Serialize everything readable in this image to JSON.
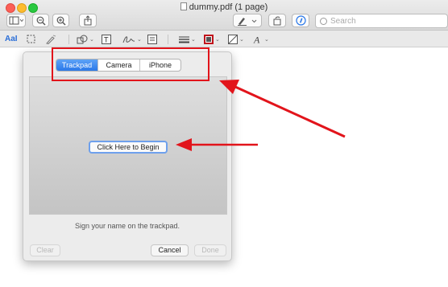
{
  "window": {
    "title": "dummy.pdf (1 page)"
  },
  "toolbar": {
    "search_placeholder": "Search"
  },
  "markup": {
    "text_label": "AaI"
  },
  "signature_panel": {
    "tabs": [
      {
        "label": "Trackpad",
        "active": true
      },
      {
        "label": "Camera",
        "active": false
      },
      {
        "label": "iPhone",
        "active": false
      }
    ],
    "begin_label": "Click Here to Begin",
    "hint": "Sign your name on the trackpad.",
    "clear_label": "Clear",
    "cancel_label": "Cancel",
    "done_label": "Done"
  },
  "annotation_color": "#e2141b",
  "accent_color": "#2a78e9"
}
